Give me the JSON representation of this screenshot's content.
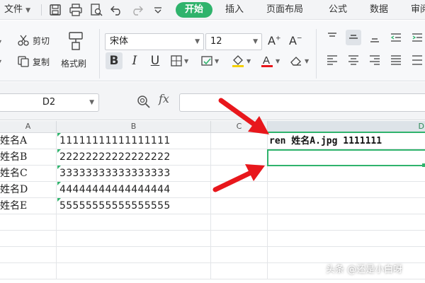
{
  "menu": {
    "file_label": "文件",
    "tabs": [
      "开始",
      "插入",
      "页面布局",
      "公式",
      "数据",
      "审阅"
    ]
  },
  "ribbon": {
    "cut_label": "剪切",
    "copy_label": "复制",
    "format_painter_label": "格式刷",
    "font_name": "宋体",
    "font_size": "12"
  },
  "formula_bar": {
    "name_box": "D2",
    "fx_label": "fx",
    "formula": ""
  },
  "sheet": {
    "columns": [
      "A",
      "B",
      "C",
      "D"
    ],
    "rows": [
      {
        "a": "姓名A",
        "b": "11111111111111111",
        "d": "ren 姓名A.jpg 1111111"
      },
      {
        "a": "姓名B",
        "b": "22222222222222222",
        "d": ""
      },
      {
        "a": "姓名C",
        "b": "33333333333333333",
        "d": ""
      },
      {
        "a": "姓名D",
        "b": "44444444444444444",
        "d": ""
      },
      {
        "a": "姓名E",
        "b": "55555555555555555",
        "d": ""
      },
      {
        "a": "",
        "b": "",
        "d": ""
      },
      {
        "a": "",
        "b": "",
        "d": ""
      },
      {
        "a": "",
        "b": "",
        "d": ""
      },
      {
        "a": "",
        "b": "",
        "d": ""
      }
    ],
    "selected_column": "D",
    "accent_color": "#2fb36c",
    "arrow_color": "#e8171c"
  },
  "watermark": "头条 @还是小白呀"
}
